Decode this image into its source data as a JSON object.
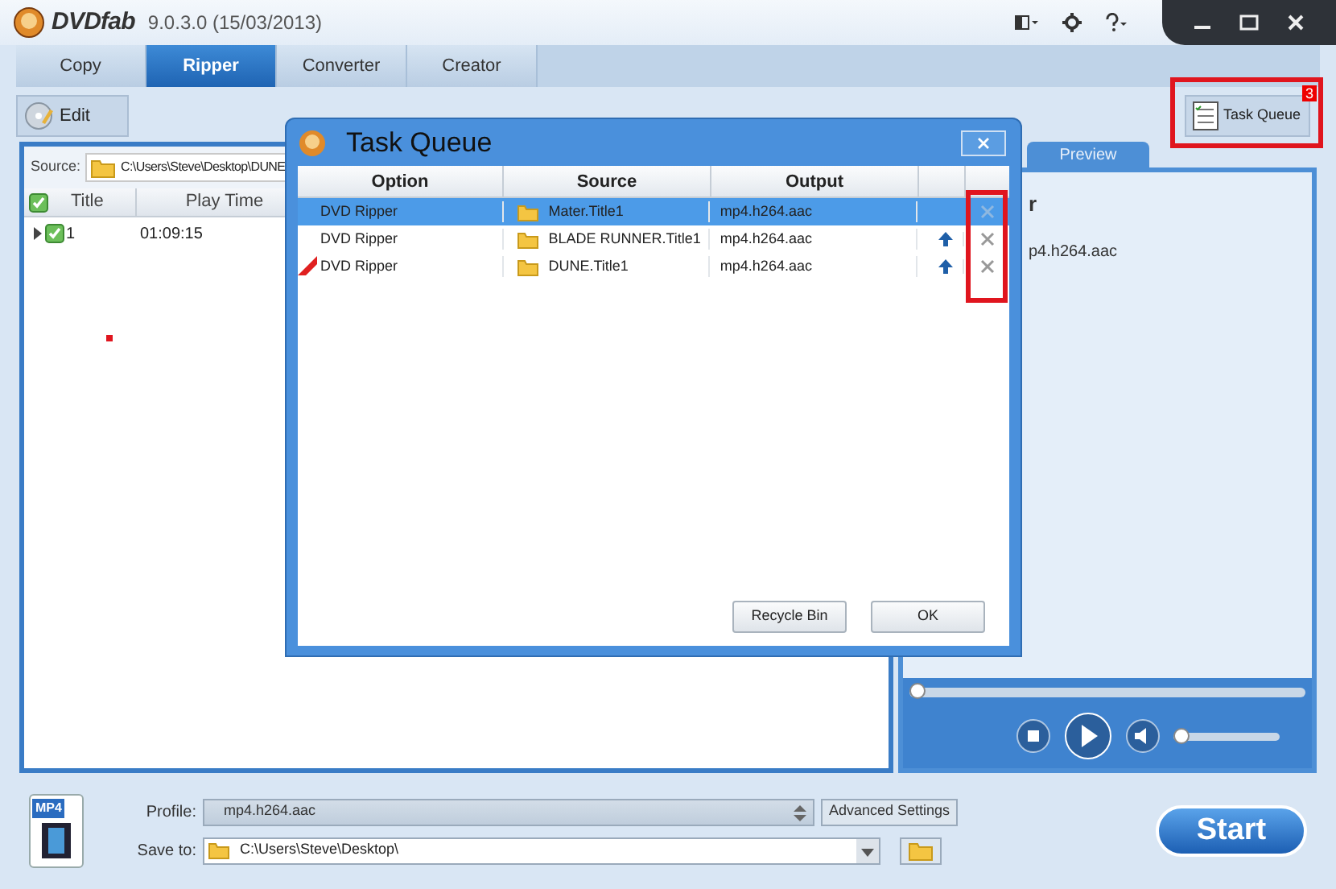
{
  "window": {
    "logo": "DVDfab",
    "version": "9.0.3.0 (15/03/2013)"
  },
  "tabs": [
    {
      "label": "Copy",
      "selected": false
    },
    {
      "label": "Ripper",
      "selected": true
    },
    {
      "label": "Converter",
      "selected": false
    },
    {
      "label": "Creator",
      "selected": false
    }
  ],
  "toolbar": {
    "edit": "Edit",
    "task_queue": {
      "label": "Task Queue",
      "badge": "3"
    }
  },
  "source": {
    "label": "Source:",
    "value": "C:\\Users\\Steve\\Desktop\\DUNE"
  },
  "titles_table": {
    "all_checked": true,
    "columns": [
      "Title",
      "Play Time"
    ],
    "rows": [
      {
        "title": "1",
        "play_time": "01:09:15",
        "checked": true,
        "expanded": false
      }
    ]
  },
  "right_panel": {
    "tab": "Preview",
    "heading": "r",
    "profile_text": "p4.h264.aac"
  },
  "player": {
    "seek": {
      "level": 0
    },
    "volume": {
      "level": 0
    }
  },
  "bottom": {
    "format_badge": "MP4",
    "profile_label": "Profile:",
    "profile": "mp4.h264.aac",
    "advanced": "Advanced Settings",
    "save_label": "Save to:",
    "save_path": "C:\\Users\\Steve\\Desktop\\",
    "start": "Start"
  },
  "dialog": {
    "title": "Task Queue",
    "columns": [
      "Option",
      "Source",
      "Output"
    ],
    "rows": [
      {
        "option": "DVD Ripper",
        "source": "Mater.Title1",
        "output": "mp4.h264.aac",
        "selected": true,
        "new": false,
        "movable": false
      },
      {
        "option": "DVD Ripper",
        "source": "BLADE RUNNER.Title1",
        "output": "mp4.h264.aac",
        "selected": false,
        "new": false,
        "movable": true
      },
      {
        "option": "DVD Ripper",
        "source": "DUNE.Title1",
        "output": "mp4.h264.aac",
        "selected": false,
        "new": true,
        "movable": true
      }
    ],
    "buttons": [
      "Recycle Bin",
      "OK"
    ]
  }
}
